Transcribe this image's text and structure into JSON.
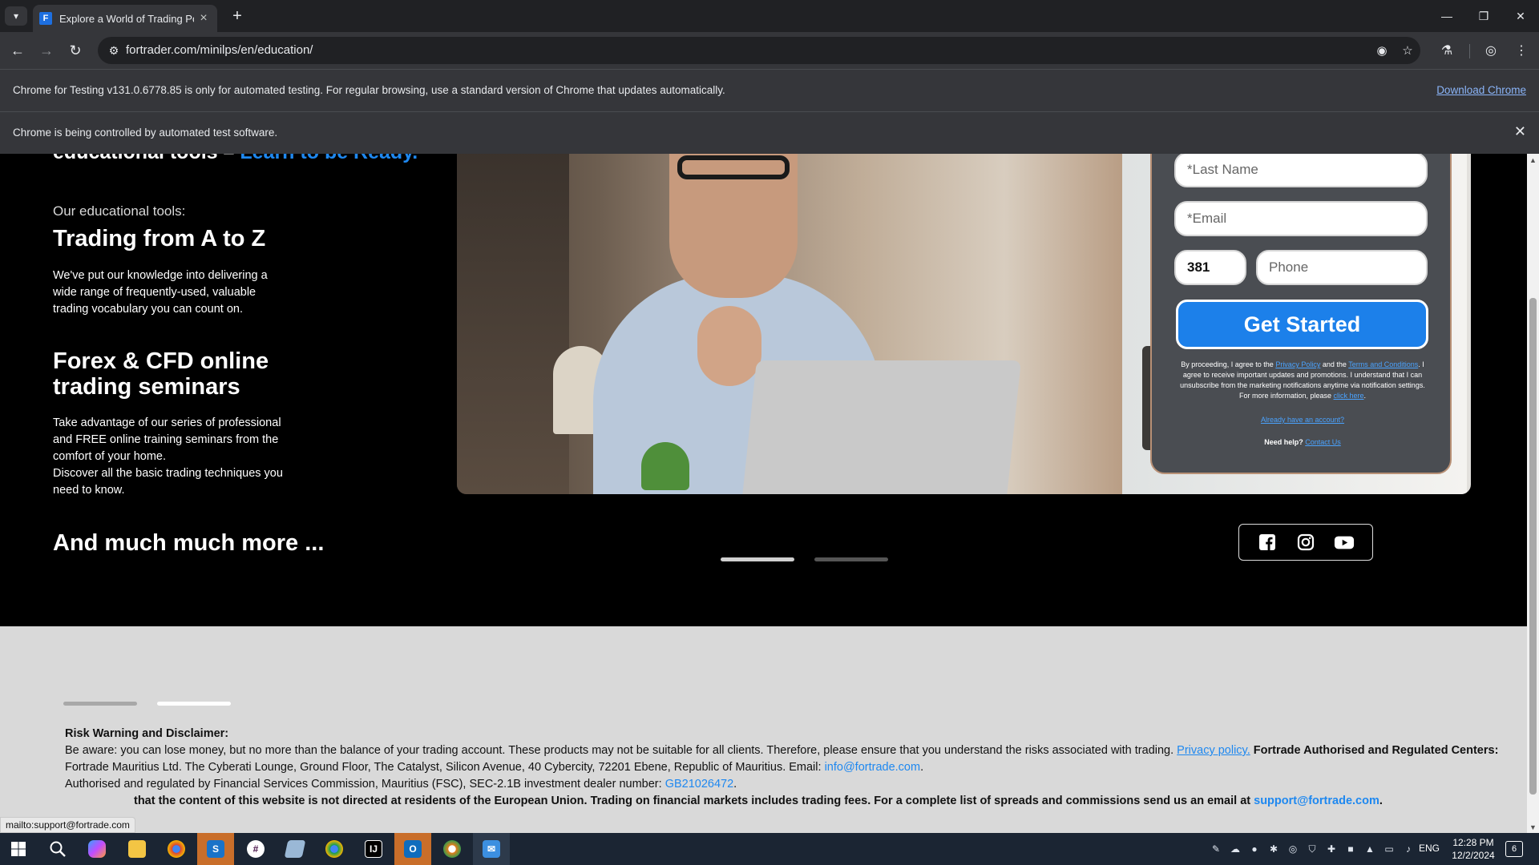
{
  "browser": {
    "tab_title": "Explore a World of Trading Possi",
    "tab_favicon_letter": "F",
    "url": "fortrader.com/minilps/en/education/",
    "infobar_testing": {
      "message": "Chrome for Testing v131.0.6778.85 is only for automated testing. For regular browsing, use a standard version of Chrome that updates automatically.",
      "link": "Download Chrome"
    },
    "infobar_automation": {
      "message": "Chrome is being controlled by automated test software."
    }
  },
  "hero": {
    "intro_text": "educational tools – ",
    "intro_accent": "Learn to be Ready.",
    "tools_label": "Our educational tools:",
    "section1_title": "Trading from A to Z",
    "section1_text": [
      "We've put our knowledge into delivering a",
      "wide range of frequently-used, valuable",
      "trading vocabulary you can count on."
    ],
    "section2_title": [
      "Forex & CFD online",
      "trading seminars"
    ],
    "section2_text": [
      "Take advantage of our series of professional",
      "and FREE online training seminars from the",
      "comfort of your home.",
      "Discover all the basic trading techniques you",
      "need to know."
    ],
    "more_title": "And much much more ..."
  },
  "form": {
    "last_name_placeholder": "*Last Name",
    "email_placeholder": "*Email",
    "country_code": "381",
    "phone_placeholder": "Phone",
    "cta": "Get Started",
    "consent_1": "By proceeding, I agree to the ",
    "privacy_policy": "Privacy Policy",
    "consent_2": " and the ",
    "terms": "Terms and Conditions",
    "consent_3": ". I agree to receive important updates and promotions. I understand that I can unsubscribe from the marketing notifications anytime via notification settings. For more information, please ",
    "click_here": "click here",
    "consent_4": ".",
    "account_link": "Already have an account?",
    "help_label": "Need help? ",
    "contact_link": "Contact Us"
  },
  "social": {
    "icons": [
      "facebook-icon",
      "instagram-icon",
      "youtube-icon"
    ]
  },
  "disclaimer": {
    "title": "Risk Warning and Disclaimer:",
    "line1": "Be aware: you can lose money, but no more than the balance of your trading account. These products may not be suitable for all clients. Therefore, please ensure that you understand the risks associated with trading. ",
    "privacy_link": "Privacy policy.",
    "authorised_heading": " Fortrade Authorised and Regulated Centers:",
    "line2": "Fortrade Mauritius Ltd. The Cyberati Lounge, Ground Floor, The Catalyst, Silicon Avenue, 40 Cybercity, 72201 Ebene, Republic of Mauritius. Email: ",
    "email_info": "info@fortrade.com",
    "line2_end": ".",
    "line3": "Authorised and regulated by Financial Services Commission, Mauritius (FSC), SEC-2.1B investment dealer number: ",
    "dealer_number": "GB21026472",
    "line3_end": ".",
    "line4": "that the content of this website is not directed at residents of the European Union. Trading on financial markets includes trading fees. For a complete list of spreads and commissions send us an email at ",
    "email_support": "support@fortrade.com",
    "line4_end": "."
  },
  "status_url": "mailto:support@fortrade.com",
  "taskbar": {
    "language": "ENG",
    "time": "12:28 PM",
    "date": "12/2/2024",
    "notification_count": "6"
  },
  "colors": {
    "accent_blue": "#1e88f0",
    "cta_blue": "#1c80ea",
    "form_bg": "#4a4d52",
    "chrome_dark": "#202124"
  }
}
